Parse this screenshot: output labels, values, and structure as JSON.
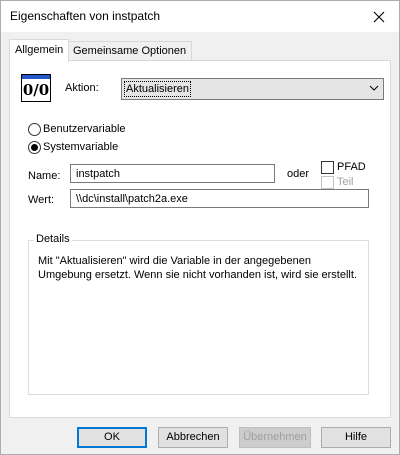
{
  "window": {
    "title": "Eigenschaften von instpatch"
  },
  "tabs": [
    {
      "label": "Allgemein",
      "active": true
    },
    {
      "label": "Gemeinsame Optionen",
      "active": false
    }
  ],
  "action": {
    "icon_glyph": "0/0",
    "label": "Aktion:",
    "selected": "Aktualisieren"
  },
  "variable_type": {
    "options": [
      {
        "label": "Benutzervariable",
        "selected": false
      },
      {
        "label": "Systemvariable",
        "selected": true
      }
    ]
  },
  "name_field": {
    "label": "Name:",
    "value": "instpatch",
    "or_label": "oder"
  },
  "path_options": {
    "pfad_label": "PFAD",
    "pfad_checked": false,
    "teil_label": "Teil",
    "teil_checked": false,
    "teil_enabled": false
  },
  "value_field": {
    "label": "Wert:",
    "value": "\\\\dc\\install\\patch2a.exe"
  },
  "details": {
    "title": "Details",
    "text": "Mit \"Aktualisieren\" wird die Variable in der angegebenen Umgebung ersetzt. Wenn sie nicht vorhanden ist, wird sie erstellt."
  },
  "buttons": {
    "ok": "OK",
    "cancel": "Abbrechen",
    "apply": "Übernehmen",
    "help": "Hilfe"
  }
}
